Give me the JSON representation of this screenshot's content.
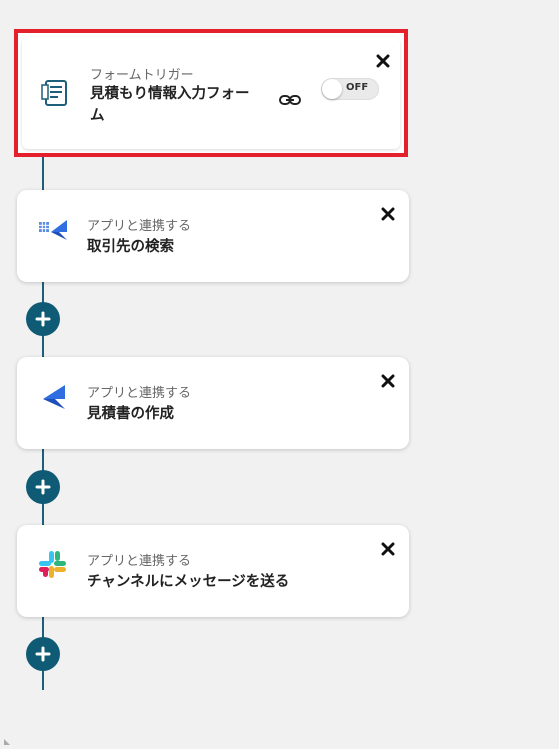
{
  "steps": [
    {
      "subtitle": "フォームトリガー",
      "title": "見積もり情報入力フォーム",
      "icon": "form-icon",
      "toggle_label": "OFF"
    },
    {
      "subtitle": "アプリと連携する",
      "title": "取引先の検索",
      "icon": "app-table-swallow-icon"
    },
    {
      "subtitle": "アプリと連携する",
      "title": "見積書の作成",
      "icon": "swallow-icon"
    },
    {
      "subtitle": "アプリと連携する",
      "title": "チャンネルにメッセージを送る",
      "icon": "slack-icon"
    }
  ],
  "colors": {
    "highlight": "#e3202b",
    "add_button": "#0f5a74",
    "timeline": "#1d5e7a"
  }
}
